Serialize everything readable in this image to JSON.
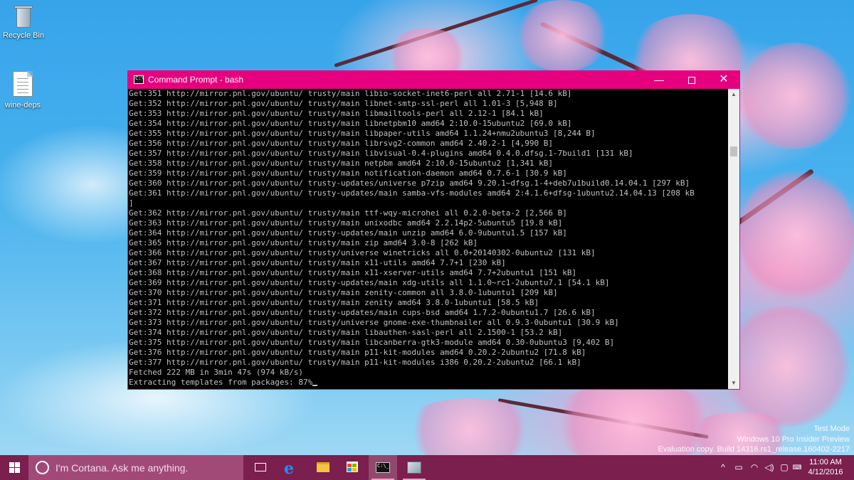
{
  "desktop": {
    "icons": [
      {
        "label": "Recycle Bin",
        "icon": "recycle-bin-icon"
      },
      {
        "label": "wine-deps",
        "icon": "text-document-icon"
      }
    ]
  },
  "window": {
    "title": "Command Prompt - bash",
    "icon": "command-prompt-icon",
    "controls": {
      "minimize": "—",
      "close": "✕"
    },
    "console_lines": [
      "Get:351 http://mirror.pnl.gov/ubuntu/ trusty/main libio-socket-inet6-perl all 2.71-1 [14.6 kB]",
      "Get:352 http://mirror.pnl.gov/ubuntu/ trusty/main libnet-smtp-ssl-perl all 1.01-3 [5,948 B]",
      "Get:353 http://mirror.pnl.gov/ubuntu/ trusty/main libmailtools-perl all 2.12-1 [84.1 kB]",
      "Get:354 http://mirror.pnl.gov/ubuntu/ trusty/main libnetpbm10 amd64 2:10.0-15ubuntu2 [69.0 kB]",
      "Get:355 http://mirror.pnl.gov/ubuntu/ trusty/main libpaper-utils amd64 1.1.24+nmu2ubuntu3 [8,244 B]",
      "Get:356 http://mirror.pnl.gov/ubuntu/ trusty/main librsvg2-common amd64 2.40.2-1 [4,990 B]",
      "Get:357 http://mirror.pnl.gov/ubuntu/ trusty/main libvisual-0.4-plugins amd64 0.4.0.dfsg.1-7build1 [131 kB]",
      "Get:358 http://mirror.pnl.gov/ubuntu/ trusty/main netpbm amd64 2:10.0-15ubuntu2 [1,341 kB]",
      "Get:359 http://mirror.pnl.gov/ubuntu/ trusty/main notification-daemon amd64 0.7.6-1 [30.9 kB]",
      "Get:360 http://mirror.pnl.gov/ubuntu/ trusty-updates/universe p7zip amd64 9.20.1~dfsg.1-4+deb7u1build0.14.04.1 [297 kB]",
      "Get:361 http://mirror.pnl.gov/ubuntu/ trusty-updates/main samba-vfs-modules amd64 2:4.1.6+dfsg-1ubuntu2.14.04.13 [208 kB",
      "]",
      "Get:362 http://mirror.pnl.gov/ubuntu/ trusty/main ttf-wqy-microhei all 0.2.0-beta-2 [2,566 B]",
      "Get:363 http://mirror.pnl.gov/ubuntu/ trusty/main unixodbc amd64 2.2.14p2-5ubuntu5 [19.8 kB]",
      "Get:364 http://mirror.pnl.gov/ubuntu/ trusty-updates/main unzip amd64 6.0-9ubuntu1.5 [157 kB]",
      "Get:365 http://mirror.pnl.gov/ubuntu/ trusty/main zip amd64 3.0-8 [262 kB]",
      "Get:366 http://mirror.pnl.gov/ubuntu/ trusty/universe winetricks all 0.0+20140302-0ubuntu2 [131 kB]",
      "Get:367 http://mirror.pnl.gov/ubuntu/ trusty/main x11-utils amd64 7.7+1 [230 kB]",
      "Get:368 http://mirror.pnl.gov/ubuntu/ trusty/main x11-xserver-utils amd64 7.7+2ubuntu1 [151 kB]",
      "Get:369 http://mirror.pnl.gov/ubuntu/ trusty-updates/main xdg-utils all 1.1.0~rc1-2ubuntu7.1 [54.1 kB]",
      "Get:370 http://mirror.pnl.gov/ubuntu/ trusty/main zenity-common all 3.8.0-1ubuntu1 [209 kB]",
      "Get:371 http://mirror.pnl.gov/ubuntu/ trusty/main zenity amd64 3.8.0-1ubuntu1 [58.5 kB]",
      "Get:372 http://mirror.pnl.gov/ubuntu/ trusty-updates/main cups-bsd amd64 1.7.2-0ubuntu1.7 [26.6 kB]",
      "Get:373 http://mirror.pnl.gov/ubuntu/ trusty/universe gnome-exe-thumbnailer all 0.9.3-0ubuntu1 [30.9 kB]",
      "Get:374 http://mirror.pnl.gov/ubuntu/ trusty/main libauthen-sasl-perl all 2.1500-1 [53.2 kB]",
      "Get:375 http://mirror.pnl.gov/ubuntu/ trusty/main libcanberra-gtk3-module amd64 0.30-0ubuntu3 [9,402 B]",
      "Get:376 http://mirror.pnl.gov/ubuntu/ trusty/main p11-kit-modules amd64 0.20.2-2ubuntu2 [71.8 kB]",
      "Get:377 http://mirror.pnl.gov/ubuntu/ trusty/main p11-kit-modules i386 0.20.2-2ubuntu2 [66.1 kB]",
      "Fetched 222 MB in 3min 47s (974 kB/s)"
    ],
    "prompt_line": "Extracting templates from packages: 87%"
  },
  "watermark": {
    "line1": "Test Mode",
    "line2": "Windows 10 Pro Insider Preview",
    "line3": "Evaluation copy. Build 14316.rs1_release.160402-2217"
  },
  "taskbar": {
    "search_placeholder": "I'm Cortana. Ask me anything.",
    "pinned": [
      {
        "name": "task-view",
        "icon": "task-view-icon"
      },
      {
        "name": "edge",
        "icon": "edge-browser-icon",
        "glyph": "e"
      },
      {
        "name": "file-explorer",
        "icon": "folder-icon"
      },
      {
        "name": "store",
        "icon": "store-icon"
      },
      {
        "name": "command-prompt",
        "icon": "command-prompt-icon",
        "glyph": "C:\\_"
      },
      {
        "name": "wine-app",
        "icon": "wine-app-icon"
      }
    ],
    "tray": {
      "chevron": "^",
      "battery": "▭",
      "wifi": "◠",
      "volume": "◁)",
      "notifications": "▢"
    },
    "clock": {
      "time": "11:00 AM",
      "date": "4/12/2016"
    }
  },
  "colors": {
    "accent": "#e6007e",
    "taskbar": "#7a1f4e",
    "console_bg": "#000000",
    "console_fg": "#c0c0c0"
  }
}
